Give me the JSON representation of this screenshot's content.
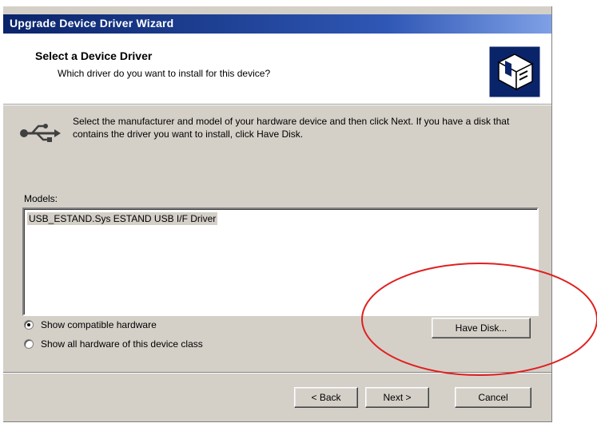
{
  "window": {
    "title": "Upgrade Device Driver Wizard"
  },
  "header": {
    "title": "Select a Device Driver",
    "subtitle": "Which driver do you want to install for this device?",
    "icon": "wizard-hardware-icon"
  },
  "instruction": {
    "icon": "usb-icon",
    "text": "Select the manufacturer and model of your hardware device and then click Next. If you have a disk that contains the driver you want to install, click Have Disk."
  },
  "models": {
    "label": "Models:",
    "items": [
      "USB_ESTAND.Sys ESTAND USB I/F Driver"
    ]
  },
  "options": {
    "compatible": "Show compatible hardware",
    "all": "Show all hardware of this device class",
    "selected": "compatible"
  },
  "buttons": {
    "have_disk": "Have Disk...",
    "back": "< Back",
    "next": "Next >",
    "cancel": "Cancel"
  },
  "annotation": {
    "shape": "ellipse",
    "color": "#e02020",
    "target": "have_disk"
  }
}
